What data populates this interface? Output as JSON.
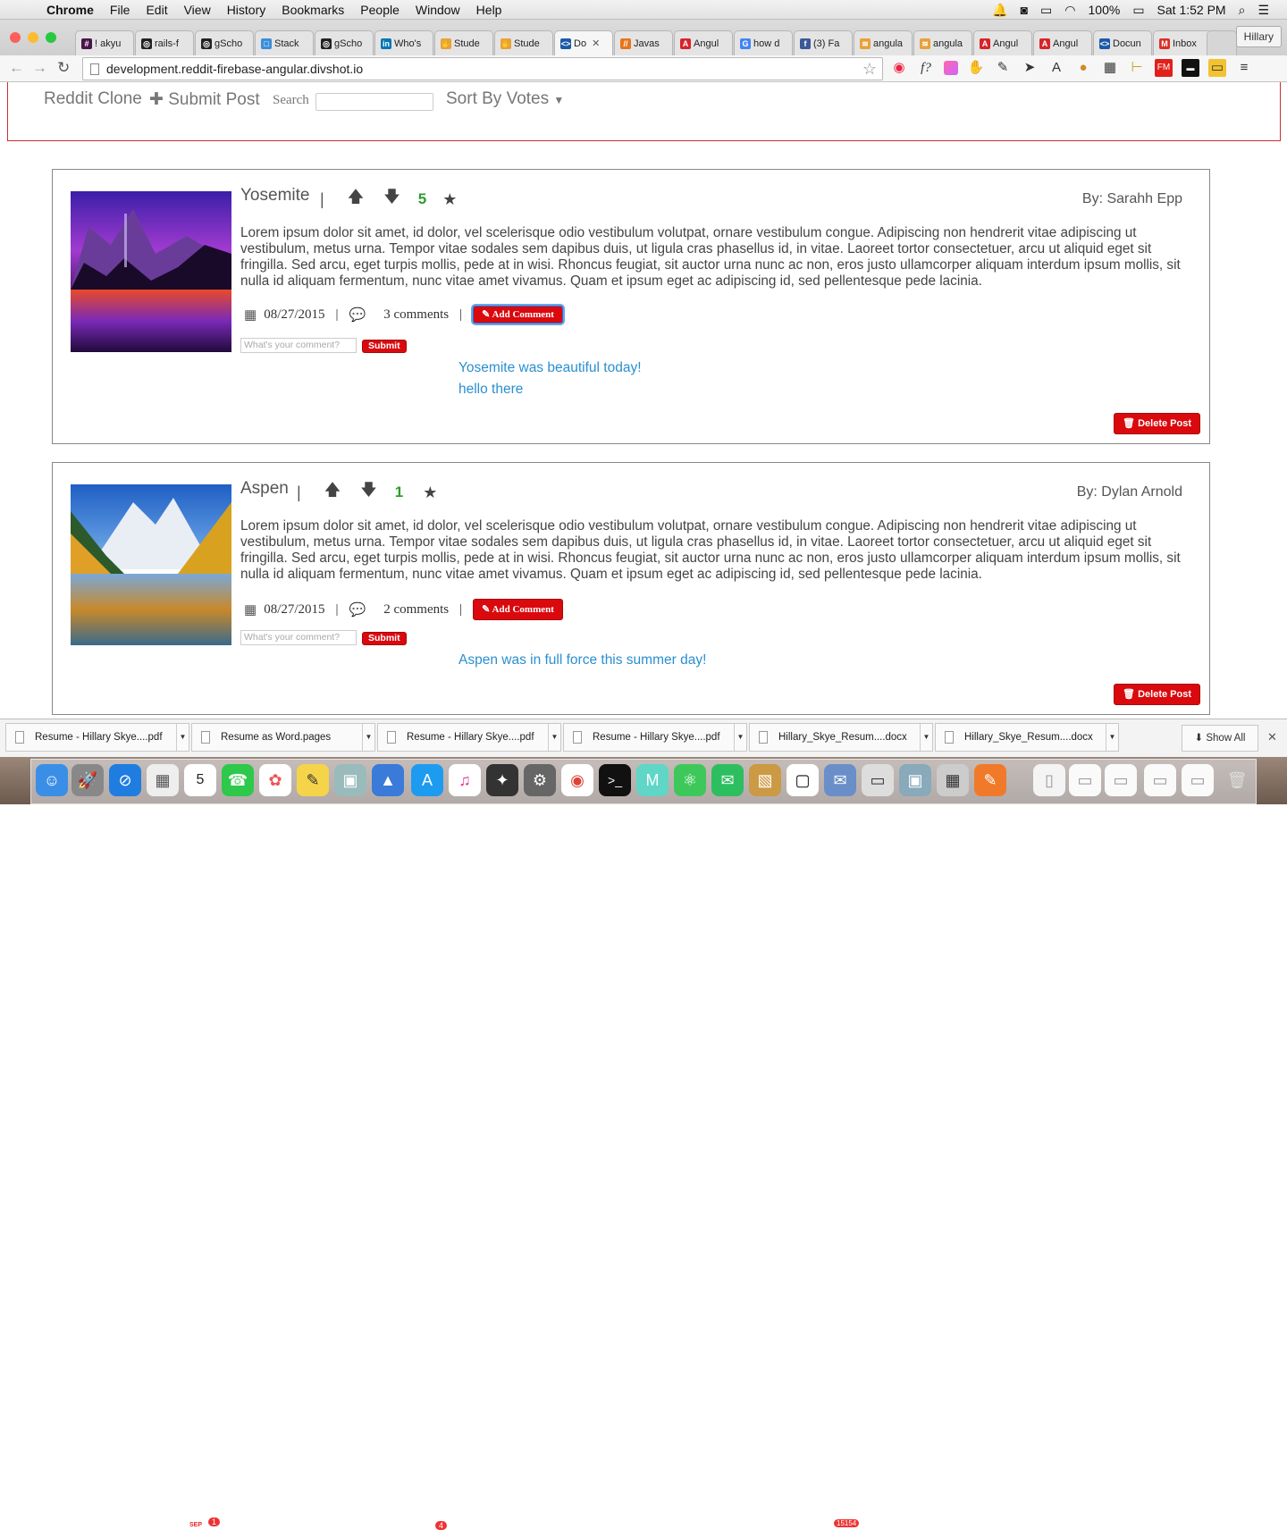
{
  "menubar": {
    "app": "Chrome",
    "items": [
      "File",
      "Edit",
      "View",
      "History",
      "Bookmarks",
      "People",
      "Window",
      "Help"
    ],
    "battery": "100%",
    "clock": "Sat 1:52 PM"
  },
  "tabs": [
    {
      "label": "! akyu",
      "color": "#4a154b",
      "glyph": "#"
    },
    {
      "label": "rails-f",
      "color": "#222",
      "glyph": "◎"
    },
    {
      "label": "gScho",
      "color": "#222",
      "glyph": "◎"
    },
    {
      "label": "Stack",
      "color": "#3b8fd9",
      "glyph": "□"
    },
    {
      "label": "gScho",
      "color": "#222",
      "glyph": "◎"
    },
    {
      "label": "Who's",
      "color": "#0077b5",
      "glyph": "in"
    },
    {
      "label": "Stude",
      "color": "#e8a13a",
      "glyph": "✋"
    },
    {
      "label": "Stude",
      "color": "#e8a13a",
      "glyph": "✋"
    },
    {
      "label": "Do",
      "color": "#1b5aa8",
      "glyph": "<>",
      "active": true
    },
    {
      "label": "Javas",
      "color": "#e8751a",
      "glyph": "//"
    },
    {
      "label": "Angul",
      "color": "#d6252a",
      "glyph": "A"
    },
    {
      "label": "how d",
      "color": "#4285f4",
      "glyph": "G"
    },
    {
      "label": "(3) Fa",
      "color": "#3b5998",
      "glyph": "f"
    },
    {
      "label": "angula",
      "color": "#e8a13a",
      "glyph": "≋"
    },
    {
      "label": "angula",
      "color": "#e8a13a",
      "glyph": "≋"
    },
    {
      "label": "Angul",
      "color": "#d6252a",
      "glyph": "A"
    },
    {
      "label": "Angul",
      "color": "#d6252a",
      "glyph": "A"
    },
    {
      "label": "Docun",
      "color": "#1b5aa8",
      "glyph": "<>"
    },
    {
      "label": "Inbox",
      "color": "#d93025",
      "glyph": "M"
    }
  ],
  "profile": "Hillary",
  "url": "development.reddit-firebase-angular.divshot.io",
  "nav": {
    "brand": "Reddit Clone",
    "submit": "Submit Post",
    "search_label": "Search",
    "sort": "Sort By Votes"
  },
  "posts": [
    {
      "title": "Yosemite",
      "votes": "5",
      "author": "By: Sarahh Epp",
      "body": "Lorem ipsum dolor sit amet, id dolor, vel scelerisque odio vestibulum volutpat, ornare vestibulum congue. Adipiscing non hendrerit vitae adipiscing ut vestibulum, metus urna. Tempor vitae sodales sem dapibus duis, ut ligula cras phasellus id, in vitae. Laoreet tortor consectetuer, arcu ut aliquid eget sit fringilla. Sed arcu, eget turpis mollis, pede at in wisi. Rhoncus feugiat, sit auctor urna nunc ac non, eros justo ullamcorper aliquam interdum ipsum mollis, sit nulla id aliquam fermentum, nunc vitae amet vivamus. Quam et ipsum eget ac adipiscing id, sed pellentesque pede lacinia.",
      "date": "08/27/2015",
      "comment_count": "3 comments",
      "add_comment": "Add Comment",
      "comment_placeholder": "What's your comment?",
      "submit": "Submit",
      "comments": [
        "Yosemite was beautiful today!",
        "hello there"
      ],
      "delete": "Delete Post"
    },
    {
      "title": "Aspen",
      "votes": "1",
      "author": "By: Dylan Arnold",
      "body": "Lorem ipsum dolor sit amet, id dolor, vel scelerisque odio vestibulum volutpat, ornare vestibulum congue. Adipiscing non hendrerit vitae adipiscing ut vestibulum, metus urna. Tempor vitae sodales sem dapibus duis, ut ligula cras phasellus id, in vitae. Laoreet tortor consectetuer, arcu ut aliquid eget sit fringilla. Sed arcu, eget turpis mollis, pede at in wisi. Rhoncus feugiat, sit auctor urna nunc ac non, eros justo ullamcorper aliquam interdum ipsum mollis, sit nulla id aliquam fermentum, nunc vitae amet vivamus. Quam et ipsum eget ac adipiscing id, sed pellentesque pede lacinia.",
      "date": "08/27/2015",
      "comment_count": "2 comments",
      "add_comment": "Add Comment",
      "comment_placeholder": "What's your comment?",
      "submit": "Submit",
      "comments": [
        "Aspen was in full force this summer day!"
      ],
      "delete": "Delete Post"
    }
  ],
  "downloads": [
    "Resume - Hillary Skye....pdf",
    "Resume as Word.pages",
    "Resume - Hillary Skye....pdf",
    "Resume - Hillary Skye....pdf",
    "Hillary_Skye_Resum....docx",
    "Hillary_Skye_Resum....docx"
  ],
  "show_all": "Show All",
  "dock": {
    "calendar_month": "SEP",
    "calendar_day": "5",
    "calendar_badge": "1",
    "appstore_badge": "4",
    "mail_badge": "15154"
  }
}
